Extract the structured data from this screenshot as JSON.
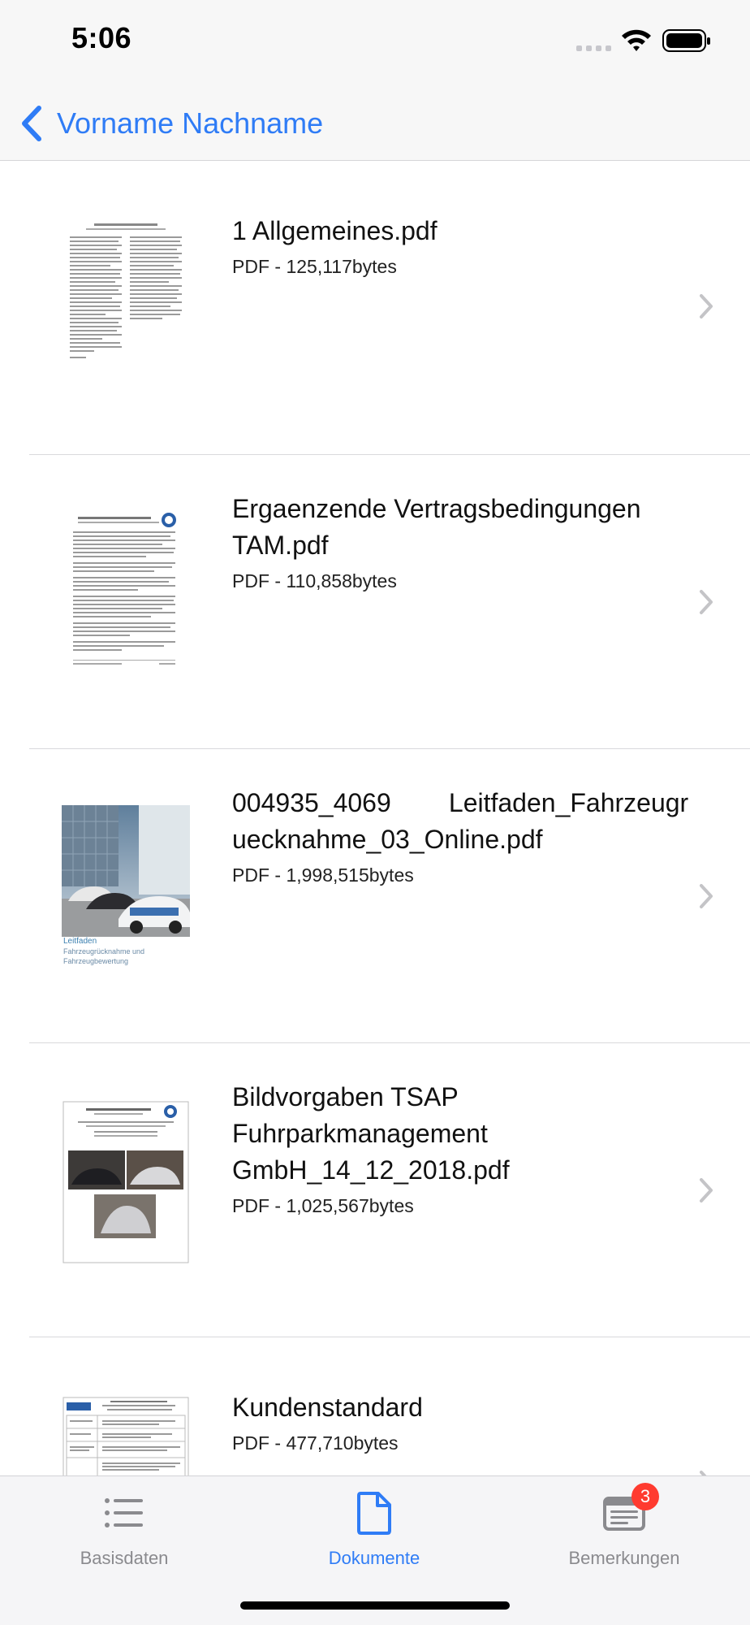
{
  "status_bar": {
    "time": "5:06"
  },
  "nav": {
    "back_label": "Vorname Nachname"
  },
  "documents": [
    {
      "title": "1 Allgemeines.pdf",
      "subtitle": "PDF - 125,117bytes",
      "thumbnail": "text-document"
    },
    {
      "title": "Ergaenzende Vertragsbedingungen TAM.pdf",
      "subtitle": "PDF - 110,858bytes",
      "thumbnail": "text-document-with-seal"
    },
    {
      "title": "004935_4069        Leitfaden_Fahrzeugruecknahme_03_Online.pdf",
      "subtitle": "PDF - 1,998,515bytes",
      "thumbnail": "car-photo-cover",
      "thumb_text_1": "Leitfaden",
      "thumb_text_2": "Fahrzeugrücknahme und",
      "thumb_text_3": "Fahrzeugbewertung"
    },
    {
      "title": "Bildvorgaben TSAP Fuhrparkmanagement GmbH_14_12_2018.pdf",
      "subtitle": "PDF - 1,025,567bytes",
      "thumbnail": "car-photos-document"
    },
    {
      "title": "Kundenstandard",
      "subtitle": "PDF - 477,710bytes",
      "thumbnail": "table-document"
    }
  ],
  "tabs": [
    {
      "label": "Basisdaten",
      "icon": "list-icon",
      "active": false
    },
    {
      "label": "Dokumente",
      "icon": "document-icon",
      "active": true
    },
    {
      "label": "Bemerkungen",
      "icon": "notes-icon",
      "active": false,
      "badge": "3"
    }
  ],
  "colors": {
    "accent": "#2f7cf6",
    "badge": "#ff3b30",
    "inactive": "#8a8a8e"
  }
}
